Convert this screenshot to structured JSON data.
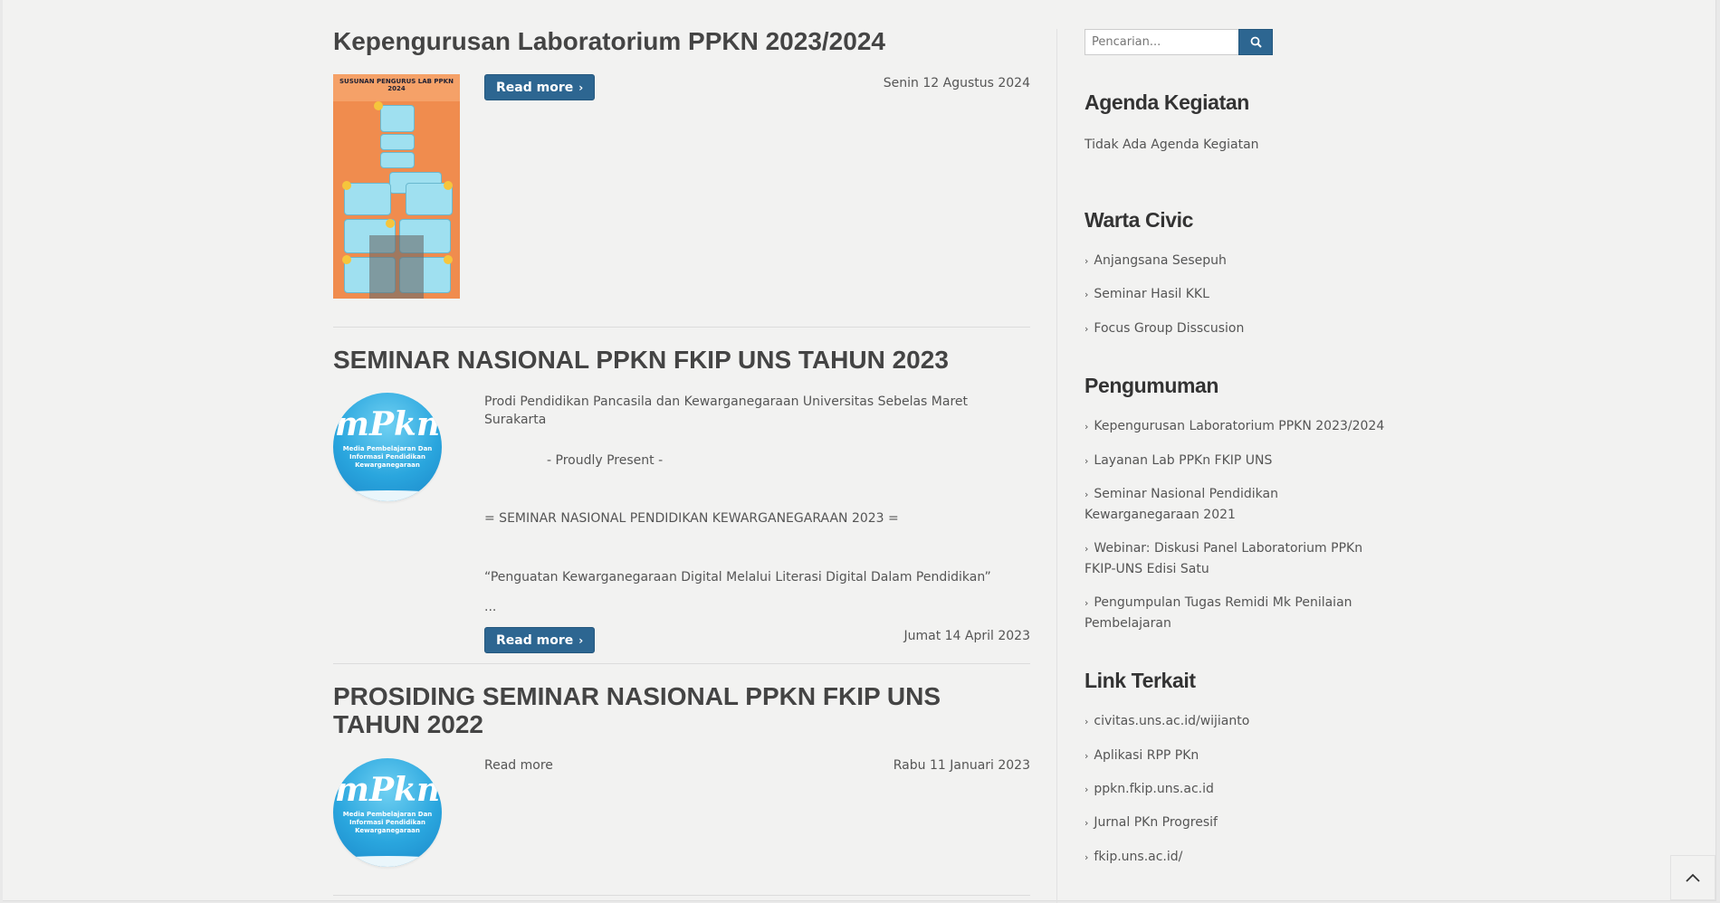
{
  "posts": [
    {
      "title": "Kepengurusan Laboratorium PPKN 2023/2024",
      "date": "Senin 12 Agustus 2024",
      "read_more": "Read more",
      "poster_header": "SUSUNAN PENGURUS LAB PPKN 2024"
    },
    {
      "title": "SEMINAR NASIONAL PPKN FKIP UNS TAHUN 2023",
      "excerpt": [
        "Prodi Pendidikan Pancasila dan Kewarganegaraan Universitas Sebelas Maret Surakarta",
        "- Proudly Present -",
        "= SEMINAR NASIONAL PENDIDIKAN KEWARGANEGARAAN 2023 =",
        "“Penguatan Kewarganegaraan Digital Melalui Literasi Digital Dalam Pendidikan”",
        "..."
      ],
      "date": "Jumat 14 April 2023",
      "read_more": "Read more"
    },
    {
      "title": "PROSIDING SEMINAR NASIONAL PPKN FKIP UNS TAHUN 2022",
      "date": "Rabu 11 Januari 2023",
      "read_more": "Read more"
    }
  ],
  "logo": {
    "mark": "mPkn",
    "tagline": "Media Pembelajaran Dan Informasi Pendidikan Kewarganegaraan"
  },
  "sidebar": {
    "search_placeholder": "Pencarian...",
    "agenda": {
      "title": "Agenda Kegiatan",
      "empty_text": "Tidak Ada Agenda Kegiatan"
    },
    "warta": {
      "title": "Warta Civic",
      "items": [
        "Anjangsana Sesepuh",
        "Seminar Hasil KKL",
        "Focus Group Disscusion"
      ]
    },
    "pengumuman": {
      "title": "Pengumuman",
      "items": [
        "Kepengurusan Laboratorium PPKN 2023/2024",
        "Layanan Lab PPKn FKIP UNS",
        "Seminar Nasional Pendidikan Kewarganegaraan 2021",
        "Webinar: Diskusi Panel Laboratorium PPKn FKIP-UNS Edisi Satu",
        "Pengumpulan Tugas Remidi Mk Penilaian Pembelajaran"
      ]
    },
    "links": {
      "title": "Link Terkait",
      "items": [
        "civitas.uns.ac.id/wijianto",
        "Aplikasi RPP PKn",
        "ppkn.fkip.uns.ac.id",
        "Jurnal PKn Progresif",
        "fkip.uns.ac.id/"
      ]
    }
  },
  "colors": {
    "accent": "#2d6691",
    "background": "#f2f2f1",
    "heading": "#444444"
  },
  "icons": {
    "search": "search-icon",
    "chevron": "chevron-right-icon",
    "back_to_top": "chevron-up-icon"
  }
}
